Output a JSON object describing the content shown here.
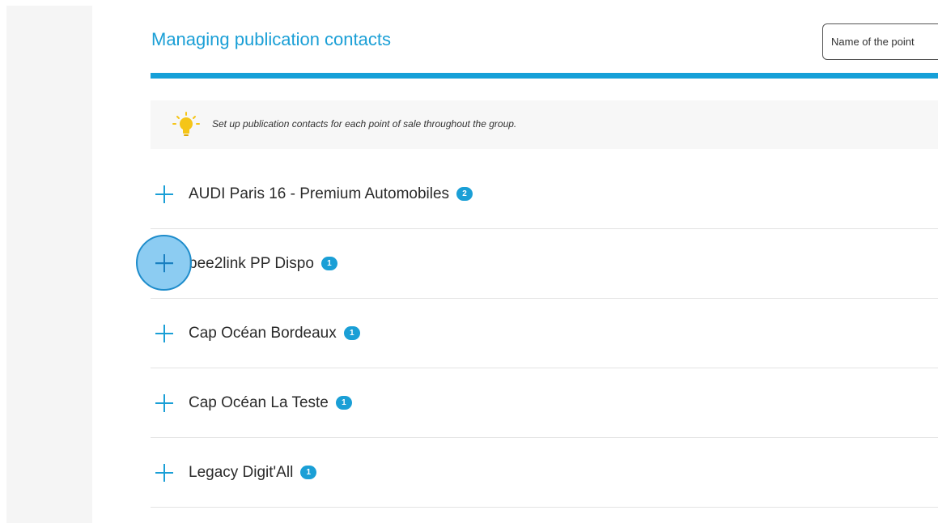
{
  "header": {
    "title": "Managing publication contacts",
    "search_placeholder": "Name of the point"
  },
  "info_banner": {
    "icon": "lightbulb-icon",
    "text": "Set up publication contacts for each point of sale throughout the group."
  },
  "contacts": [
    {
      "name": "AUDI Paris 16 - Premium Automobiles",
      "count": "2"
    },
    {
      "name": "bee2link PP Dispo",
      "count": "1"
    },
    {
      "name": "Cap Océan Bordeaux",
      "count": "1"
    },
    {
      "name": "Cap Océan La Teste",
      "count": "1"
    },
    {
      "name": "Legacy Digit'All",
      "count": "1"
    }
  ],
  "colors": {
    "accent": "#1a9fd6",
    "banner_bg": "#f7f7f7",
    "sidebar_bg": "#f5f5f5",
    "bulb": "#f5c518"
  }
}
